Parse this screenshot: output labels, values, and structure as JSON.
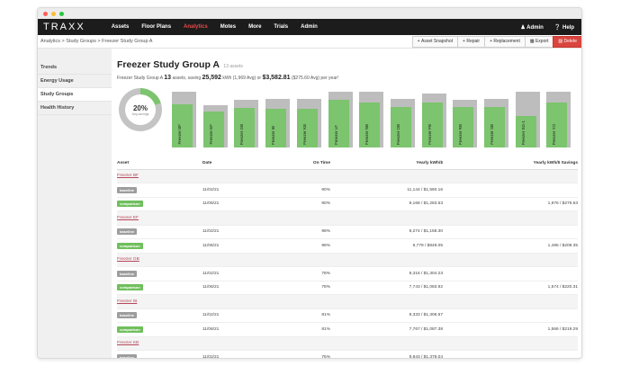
{
  "window": {
    "dot_colors": [
      "#fe5f57",
      "#febc2e",
      "#28c840"
    ]
  },
  "nav": {
    "brand": "TRAXX",
    "items": [
      "Assets",
      "Floor Plans",
      "Analytics",
      "Motes",
      "More",
      "Trials",
      "Admin"
    ],
    "active_item": "Analytics",
    "admin_label": "Admin",
    "help_label": "Help"
  },
  "breadcrumb": "Analytics  > Study Groups  > Freezer Study Group A",
  "toolbar": {
    "asset_snapshot": "Asset Snapshot",
    "repair": "Repair",
    "replacement": "Replacement",
    "export": "Export",
    "delete": "Delete"
  },
  "sidebar": {
    "items": [
      "Trends",
      "Energy Usage",
      "Study Groups",
      "Health History"
    ],
    "active": "Study Groups"
  },
  "header": {
    "title": "Freezer Study Group A",
    "count": "13 assets",
    "summary_prefix": "Freezer Study Group A",
    "summary_assets": "13",
    "summary_mid": "assets, saving",
    "summary_kwh": "25,592",
    "summary_kwh_unit": "kWh (1,969 Avg) or",
    "summary_dollars": "$3,582.81",
    "summary_tail": "($275.60 Avg) per year!"
  },
  "chart_data": {
    "type": "bar",
    "donut": {
      "percent": 20,
      "label": "20%",
      "sublabel": "Avg savings"
    },
    "categories": [
      "Freezer BF",
      "Freezer EF",
      "Freezer GB",
      "Freezer IB",
      "Freezer KB",
      "Freezer LF",
      "Freezer NB",
      "Freezer OB",
      "Freezer PB",
      "Freezer RB",
      "Freezer SB",
      "Freezer SG-1",
      "Freezer YO"
    ],
    "series": [
      {
        "values": [
          100,
          76,
          86,
          87,
          87,
          100,
          100,
          87,
          97,
          86,
          87,
          100,
          100
        ]
      },
      {
        "values": [
          77,
          64,
          71,
          69,
          69,
          85,
          80,
          72,
          80,
          72,
          72,
          57,
          80
        ]
      }
    ],
    "colors": {
      "baseline": "#bdbdbd",
      "comparison": "#7cc46e",
      "donut_track": "#c4c4c4"
    }
  },
  "table": {
    "headers": [
      "Asset",
      "Date",
      "On Time",
      "Yearly kWh/$",
      "Yearly kWh/$ Savings"
    ],
    "badge_colors": {
      "baseline": "#9d9d9d",
      "comparison": "#6fbf5d"
    },
    "groups": [
      {
        "asset": "Freezer BF",
        "rows": [
          {
            "badge": "baseline",
            "date": "11/02/21",
            "on_time": "90%",
            "kwh": "11,144 / $1,560.16",
            "savings": ""
          },
          {
            "badge": "comparison",
            "date": "11/06/21",
            "on_time": "90%",
            "kwh": "9,168 / $1,283.53",
            "savings": "1,976 / $276.63"
          }
        ]
      },
      {
        "asset": "Freezer EF",
        "rows": [
          {
            "badge": "baseline",
            "date": "11/02/21",
            "on_time": "98%",
            "kwh": "8,274 / $1,158.30",
            "savings": ""
          },
          {
            "badge": "comparison",
            "date": "11/06/21",
            "on_time": "98%",
            "kwh": "6,779 / $949.05",
            "savings": "1,495 / $209.35"
          }
        ]
      },
      {
        "asset": "Freezer GB",
        "rows": [
          {
            "badge": "baseline",
            "date": "11/02/21",
            "on_time": "78%",
            "kwh": "9,316 / $1,304.23",
            "savings": ""
          },
          {
            "badge": "comparison",
            "date": "11/06/21",
            "on_time": "78%",
            "kwh": "7,743 / $1,083.92",
            "savings": "1,574 / $220.31"
          }
        ]
      },
      {
        "asset": "Freezer IB",
        "rows": [
          {
            "badge": "baseline",
            "date": "11/02/21",
            "on_time": "81%",
            "kwh": "9,333 / $1,306.67",
            "savings": ""
          },
          {
            "badge": "comparison",
            "date": "11/06/21",
            "on_time": "81%",
            "kwh": "7,767 / $1,087.38",
            "savings": "1,566 / $219.29"
          }
        ]
      },
      {
        "asset": "Freezer KB",
        "rows": [
          {
            "badge": "baseline",
            "date": "11/02/21",
            "on_time": "76%",
            "kwh": "9,843 / $1,378.04",
            "savings": ""
          }
        ]
      }
    ]
  }
}
